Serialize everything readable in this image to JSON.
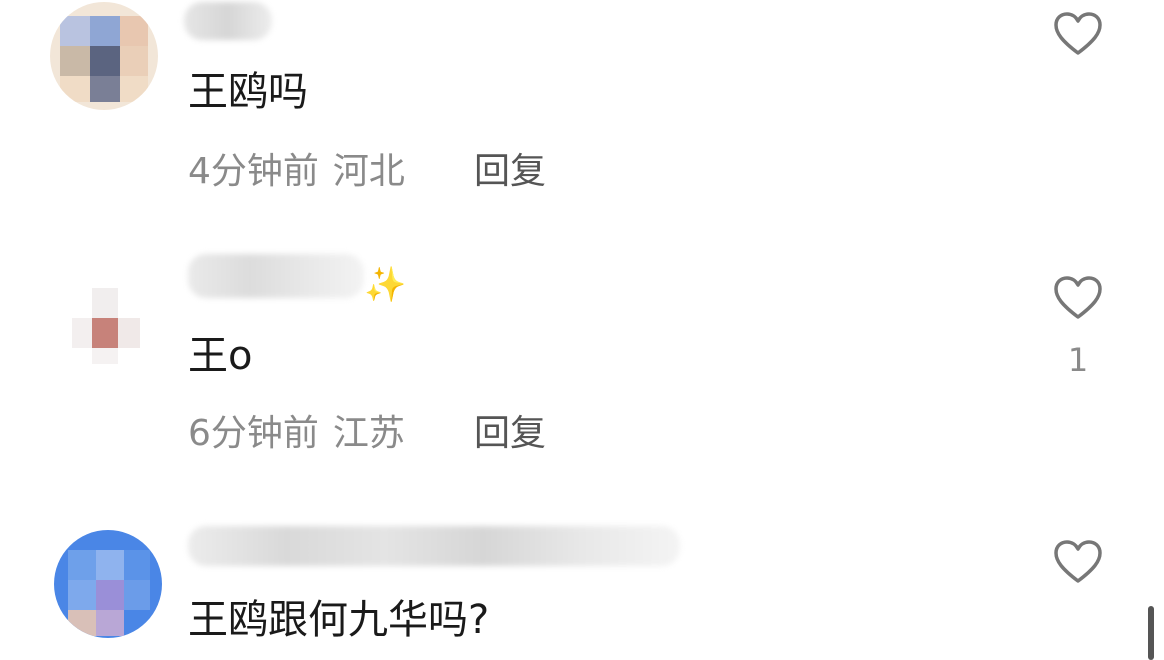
{
  "comments": [
    {
      "text": "王鸥吗",
      "time": "4分钟前",
      "location": "河北",
      "reply_label": "回复",
      "like_count": ""
    },
    {
      "text": "王o",
      "time": "6分钟前",
      "location": "江苏",
      "reply_label": "回复",
      "like_count": "1"
    },
    {
      "text": "王鸥跟何九华吗?",
      "time": "",
      "location": "",
      "reply_label": "",
      "like_count": ""
    }
  ],
  "icons": {
    "like": "heart-outline-icon",
    "sparkle": "sparkles-icon"
  },
  "colors": {
    "text": "#1a1a1a",
    "meta": "#8a8a8a",
    "reply": "#555555",
    "heart_stroke": "#777777",
    "sparkle": "#f4c542"
  },
  "sparkle_glyph": "✨"
}
